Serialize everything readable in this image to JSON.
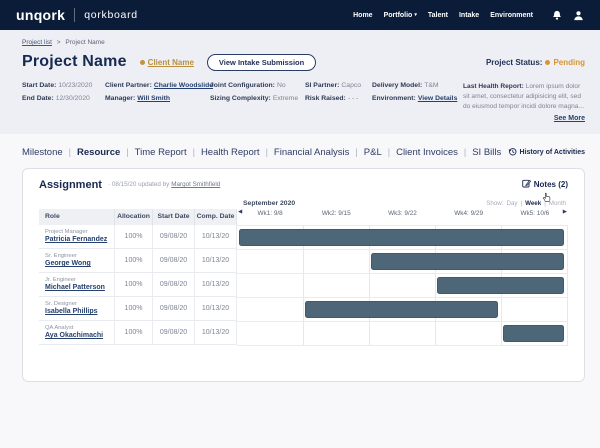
{
  "colors": {
    "navbar_bg": "#0B1C38",
    "header_bg": "#EDEFF5",
    "page_bg": "#F8F8FB",
    "navy_text": "#16294F",
    "link": "#26406E",
    "gold": "#BE9245",
    "status_orange": "#D6962F",
    "gantt_bar": "#4D6779"
  },
  "navbar": {
    "logo": "unqork",
    "app_name": "qorkboard",
    "items": [
      {
        "label": "Home"
      },
      {
        "label": "Portfolio"
      },
      {
        "label": "Talent"
      },
      {
        "label": "Intake"
      },
      {
        "label": "Environment"
      }
    ]
  },
  "breadcrumb": {
    "link": "Project list",
    "separator": ">",
    "current": "Project Name"
  },
  "header": {
    "title": "Project Name",
    "client_name": "Client Name",
    "view_intake_button": "View Intake Submission",
    "status_label": "Project Status:",
    "status_value": "Pending",
    "fields": [
      {
        "label": "Start Date:",
        "value": "10/23/2020"
      },
      {
        "label": "End Date:",
        "value": "12/30/2020"
      },
      {
        "label": "Client Partner:",
        "value": "Charlie Woodslide"
      },
      {
        "label": "Manager:",
        "value": "Will Smith"
      },
      {
        "label": "Joint Configuration:",
        "value": "No"
      },
      {
        "label": "Sizing Complexity:",
        "value": "Extreme"
      },
      {
        "label": "SI Partner:",
        "value": "Capco"
      },
      {
        "label": "Risk Raised:",
        "value": "- - -"
      },
      {
        "label": "Delivery Model:",
        "value": "T&M"
      },
      {
        "label": "Environment:",
        "value": "View Details"
      }
    ],
    "health_report": {
      "label": "Last Health Report:",
      "text": "Lorem ipsum dolor sit amet, consectetur adipisicing elit, sed do eiusmod tempor incidi dolore magna...",
      "see_more": "See More"
    }
  },
  "tabs": {
    "separator": "|",
    "items": [
      "Milestone",
      "Resource",
      "Time Report",
      "Health Report",
      "Financial Analysis",
      "P&L",
      "Client Invoices",
      "SI Bills"
    ],
    "active": "Resource",
    "history_label": "History of Activities"
  },
  "assignment": {
    "title": "Assignment",
    "updated_note": "· 08/15/20 updated by",
    "updated_by": "Margot Smithfield",
    "notes_label": "Notes (2)",
    "columns": [
      "Role",
      "Allocation",
      "Start Date",
      "Comp. Date"
    ],
    "gantt": {
      "month": "September 2020",
      "show_label": "Show:",
      "separator": "|",
      "views": [
        "Day",
        "Week",
        "Month"
      ],
      "active_view": "Week",
      "weeks": [
        "Wk1: 9/8",
        "Wk2: 9/15",
        "Wk3: 9/22",
        "Wk4: 9/29",
        "Wk5: 10/6"
      ]
    },
    "rows": [
      {
        "role": "Project Manager",
        "name": "Patricia Fernandez",
        "allocation": "100%",
        "start_date": "09/08/20",
        "comp_date": "10/13/20",
        "bar_start_week": 1,
        "bar_end_week": 5
      },
      {
        "role": "Sr. Engineer",
        "name": "George Wong",
        "allocation": "100%",
        "start_date": "09/08/20",
        "comp_date": "10/13/20",
        "bar_start_week": 3,
        "bar_end_week": 5
      },
      {
        "role": "Jr. Engineer",
        "name": "Michael Patterson",
        "allocation": "100%",
        "start_date": "09/08/20",
        "comp_date": "10/13/20",
        "bar_start_week": 4,
        "bar_end_week": 5
      },
      {
        "role": "Sr. Designer",
        "name": "Isabella Phillips",
        "allocation": "100%",
        "start_date": "09/08/20",
        "comp_date": "10/13/20",
        "bar_start_week": 2,
        "bar_end_week": 4
      },
      {
        "role": "QA Analyst",
        "name": "Aya Okachimachi",
        "allocation": "100%",
        "start_date": "09/08/20",
        "comp_date": "10/13/20",
        "bar_start_week": 5,
        "bar_end_week": 5
      }
    ]
  }
}
